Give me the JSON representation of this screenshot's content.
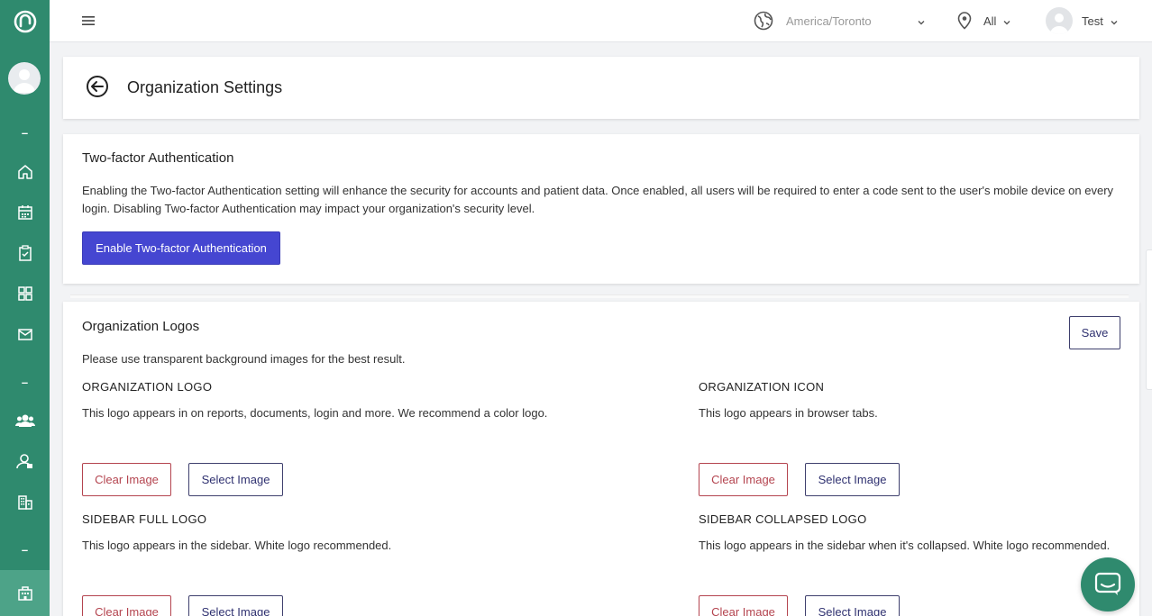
{
  "topbar": {
    "timezone": "America/Toronto",
    "location": "All",
    "user": "Test"
  },
  "header": {
    "title": "Organization Settings"
  },
  "two_factor": {
    "title": "Two-factor Authentication",
    "description": "Enabling the Two-factor Authentication setting will enhance the security for accounts and patient data. Once enabled, all users will be required to enter a code sent to the user's mobile device on every login. Disabling Two-factor Authentication may impact your organization's security level.",
    "button": "Enable Two-factor Authentication"
  },
  "logos": {
    "title": "Organization Logos",
    "save": "Save",
    "hint": "Please use transparent background images for the best result.",
    "clear_label": "Clear Image",
    "select_label": "Select Image",
    "org_logo": {
      "label": "ORGANIZATION LOGO",
      "desc": "This logo appears in on reports, documents, login and more. We recommend a color logo."
    },
    "org_icon": {
      "label": "ORGANIZATION ICON",
      "desc": "This logo appears in browser tabs."
    },
    "sidebar_full": {
      "label": "SIDEBAR FULL LOGO",
      "desc": "This logo appears in the sidebar. White logo recommended."
    },
    "sidebar_collapsed": {
      "label": "SIDEBAR COLLAPSED LOGO",
      "desc": "This logo appears in the sidebar when it's collapsed. White logo recommended."
    }
  },
  "sidebar": {
    "separator": "–",
    "items": [
      "home-icon",
      "calendar-icon",
      "clipboard-check-icon",
      "grid-icon",
      "mail-icon",
      "users-icon",
      "user-profile-icon",
      "building-icon",
      "organization-icon"
    ]
  },
  "colors": {
    "sidebar": "#2f8a6e",
    "primary_button": "#4546d1",
    "danger": "#b4444f",
    "outline": "#3e3f6d"
  }
}
